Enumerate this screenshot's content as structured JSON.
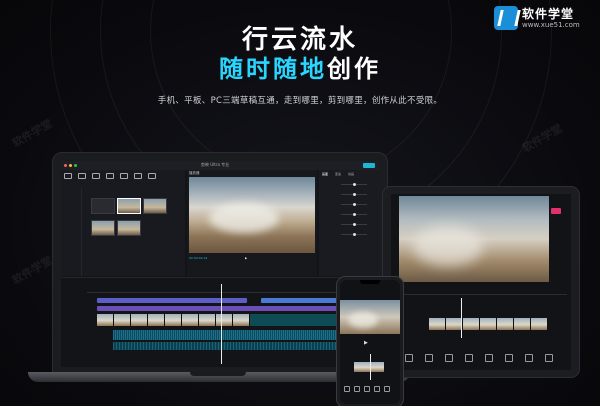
{
  "hero": {
    "title_line1": "行云流水",
    "title_highlight": "随时随地",
    "title_rest": "创作",
    "subtitle": "手机、平板、PC三端草稿互通，走到哪里，剪到哪里，创作从此不受限。"
  },
  "brand": {
    "name": "软件学堂",
    "url": "www.xue51.com"
  },
  "watermark": {
    "text": "软件学堂"
  },
  "colors": {
    "accent": "#2ad6ff",
    "export_button": "#1fb6d4",
    "tablet_export": "#e0306e",
    "background": "#0a0a0e"
  },
  "devices": {
    "laptop": {
      "window_title": "剪映 Ultra 专业",
      "preview_label": "播放器",
      "timecode": "00:00:04:19",
      "props_tabs": [
        "画面",
        "变速",
        "动画"
      ]
    },
    "tablet": {},
    "phone": {}
  }
}
